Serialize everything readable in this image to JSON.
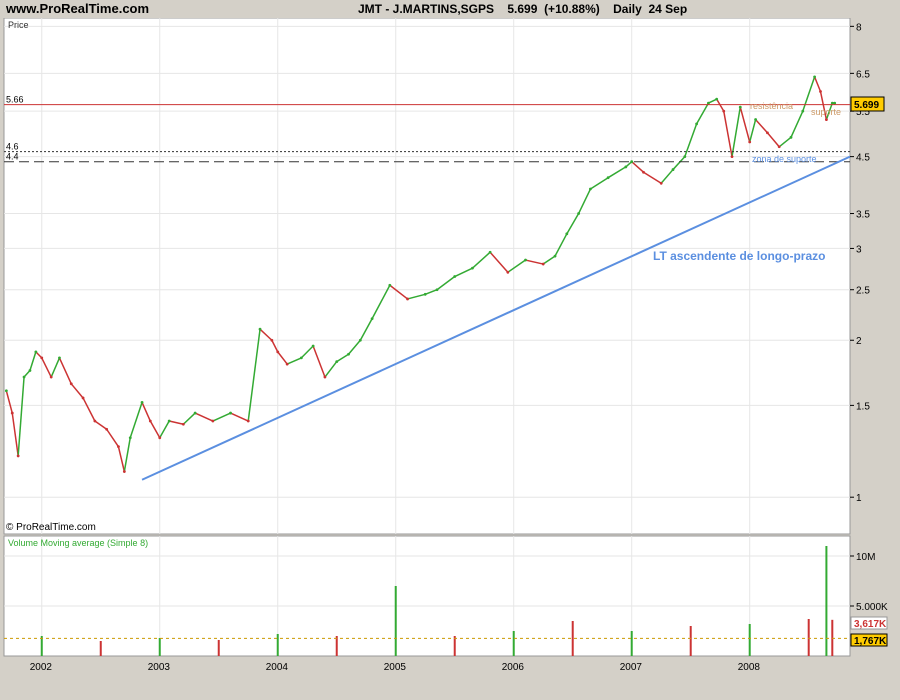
{
  "header": {
    "site": "www.ProRealTime.com",
    "symbol": "JMT - J.MARTINS,SGPS",
    "last_price": "5.699",
    "change": "(+10.88%)",
    "period": "Daily",
    "date": "24 Sep"
  },
  "price_panel": {
    "label": "Price",
    "watermark": "© ProRealTime.com",
    "annotations": {
      "trendline": "LT ascendente de longo-prazo",
      "resistance": "resistência",
      "support": "suporte",
      "support_zone": "zona de suporte"
    },
    "price_tag": "5.699",
    "tag_color": "#ffcc00"
  },
  "volume_panel": {
    "label": "Volume Moving average (Simple 8)",
    "tags": [
      "3,617K",
      "1,767K"
    ]
  },
  "colors": {
    "up": "#33aa33",
    "down": "#cc3333",
    "trendline": "#5b8fe0",
    "resistance": "#cc3333",
    "panel_bg": "#ffffff",
    "frame_bg": "#d4d0c8"
  },
  "chart_data": [
    {
      "type": "line",
      "title": "JMT - J.MARTINS,SGPS",
      "ylabel": "Price",
      "yscale": "log",
      "ylim": [
        0.85,
        8.3
      ],
      "y_ticks": [
        1,
        1.5,
        2,
        2.5,
        3,
        3.5,
        4.5,
        5.5,
        6.5,
        8
      ],
      "x_ticks": [
        "2002",
        "2003",
        "2004",
        "2005",
        "2006",
        "2007",
        "2008"
      ],
      "grid": true,
      "series": [
        {
          "x": [
            2001.7,
            2001.75,
            2001.8,
            2001.85,
            2001.9,
            2001.95,
            2002.0,
            2002.08,
            2002.15,
            2002.25,
            2002.35,
            2002.45,
            2002.55,
            2002.65,
            2002.7,
            2002.75,
            2002.85,
            2002.92,
            2003.0,
            2003.08,
            2003.2,
            2003.3,
            2003.45,
            2003.6,
            2003.75,
            2003.85,
            2003.95,
            2004.0,
            2004.08,
            2004.2,
            2004.3,
            2004.4,
            2004.5,
            2004.6,
            2004.7,
            2004.8,
            2004.95,
            2005.1,
            2005.25,
            2005.35,
            2005.5,
            2005.65,
            2005.8,
            2005.95,
            2006.1,
            2006.25,
            2006.35,
            2006.45,
            2006.55,
            2006.65,
            2006.8,
            2006.95,
            2007.0,
            2007.1,
            2007.25,
            2007.35,
            2007.45,
            2007.55,
            2007.65,
            2007.72,
            2007.78,
            2007.85,
            2007.92,
            2008.0,
            2008.05,
            2008.15,
            2008.25,
            2008.35,
            2008.45,
            2008.55,
            2008.6,
            2008.65,
            2008.7,
            2008.72
          ],
          "values": [
            1.6,
            1.45,
            1.2,
            1.7,
            1.75,
            1.9,
            1.85,
            1.7,
            1.85,
            1.65,
            1.55,
            1.4,
            1.35,
            1.25,
            1.12,
            1.3,
            1.52,
            1.4,
            1.3,
            1.4,
            1.38,
            1.45,
            1.4,
            1.45,
            1.4,
            2.1,
            2.0,
            1.9,
            1.8,
            1.85,
            1.95,
            1.7,
            1.82,
            1.88,
            2.0,
            2.2,
            2.55,
            2.4,
            2.45,
            2.5,
            2.65,
            2.75,
            2.95,
            2.7,
            2.85,
            2.8,
            2.9,
            3.2,
            3.5,
            3.9,
            4.1,
            4.3,
            4.4,
            4.2,
            4.0,
            4.25,
            4.5,
            5.2,
            5.7,
            5.8,
            5.5,
            4.5,
            5.6,
            4.8,
            5.3,
            5.0,
            4.7,
            4.9,
            5.5,
            6.4,
            6.0,
            5.3,
            5.7,
            5.7
          ]
        }
      ],
      "annotations": [
        {
          "label": "5.66",
          "y": 5.66
        },
        {
          "label": "4.6",
          "y": 4.6
        },
        {
          "label": "4.4",
          "y": 4.4
        }
      ],
      "trendline": {
        "x": [
          2002.85,
          2008.85
        ],
        "y": [
          1.08,
          4.5
        ]
      }
    },
    {
      "type": "bar",
      "title": "Volume Moving average (Simple 8)",
      "y_ticks": [
        "5.000K",
        "10M"
      ],
      "ylim": [
        0,
        12000000
      ],
      "x": [
        2002.0,
        2002.5,
        2003.0,
        2003.5,
        2004.0,
        2004.5,
        2005.0,
        2005.5,
        2006.0,
        2006.5,
        2007.0,
        2007.5,
        2008.0,
        2008.5,
        2008.65,
        2008.7
      ],
      "values": [
        2000000,
        1500000,
        1800000,
        1600000,
        2200000,
        2000000,
        7000000,
        2000000,
        2500000,
        3500000,
        2500000,
        3000000,
        3200000,
        3700000,
        11000000,
        3617000
      ],
      "moving_average_last": 1767000
    }
  ]
}
